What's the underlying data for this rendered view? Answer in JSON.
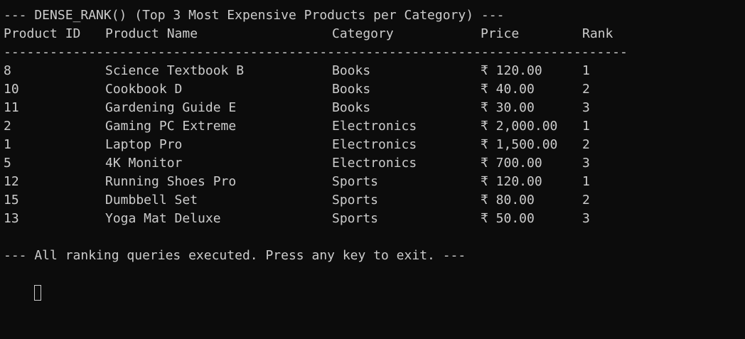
{
  "terminal": {
    "header_line": "--- DENSE_RANK() (Top 3 Most Expensive Products per Category) ---",
    "columns": {
      "id": "Product ID",
      "name": "Product Name",
      "category": "Category",
      "price": "Price",
      "rank": "Rank"
    },
    "separator": "---------------------------------------------------------------------------------",
    "rows": [
      {
        "id": "8",
        "name": "Science Textbook B",
        "category": "Books",
        "price": "₹ 120.00",
        "rank": "1"
      },
      {
        "id": "10",
        "name": "Cookbook D",
        "category": "Books",
        "price": "₹ 40.00",
        "rank": "2"
      },
      {
        "id": "11",
        "name": "Gardening Guide E",
        "category": "Books",
        "price": "₹ 30.00",
        "rank": "3"
      },
      {
        "id": "2",
        "name": "Gaming PC Extreme",
        "category": "Electronics",
        "price": "₹ 2,000.00",
        "rank": "1"
      },
      {
        "id": "1",
        "name": "Laptop Pro",
        "category": "Electronics",
        "price": "₹ 1,500.00",
        "rank": "2"
      },
      {
        "id": "5",
        "name": "4K Monitor",
        "category": "Electronics",
        "price": "₹ 700.00",
        "rank": "3"
      },
      {
        "id": "12",
        "name": "Running Shoes Pro",
        "category": "Sports",
        "price": "₹ 120.00",
        "rank": "1"
      },
      {
        "id": "15",
        "name": "Dumbbell Set",
        "category": "Sports",
        "price": "₹ 80.00",
        "rank": "2"
      },
      {
        "id": "13",
        "name": "Yoga Mat Deluxe",
        "category": "Sports",
        "price": "₹ 50.00",
        "rank": "3"
      }
    ],
    "footer_line": "--- All ranking queries executed. Press any key to exit. ---"
  }
}
